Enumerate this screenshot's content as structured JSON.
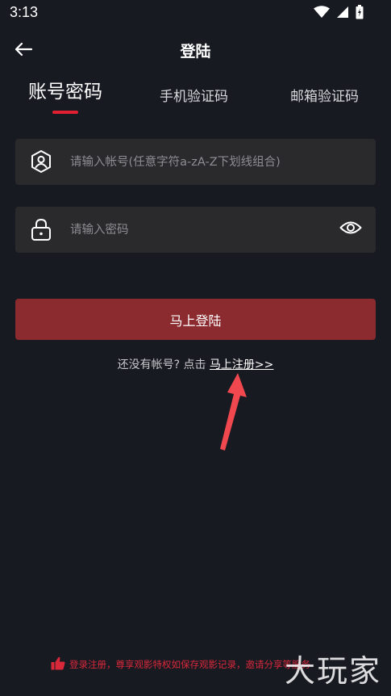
{
  "status_bar": {
    "time": "3:13"
  },
  "header": {
    "title": "登陆"
  },
  "tabs": [
    {
      "label": "账号密码",
      "active": true
    },
    {
      "label": "手机验证码",
      "active": false
    },
    {
      "label": "邮箱验证码",
      "active": false
    }
  ],
  "form": {
    "account": {
      "placeholder": "请输入帐号(任意字符a-zA-Z下划线组合)",
      "value": ""
    },
    "password": {
      "placeholder": "请输入密码",
      "value": ""
    },
    "submit_label": "马上登陆"
  },
  "register": {
    "prompt": "还没有帐号? 点击 ",
    "link_label": "马上注册>>"
  },
  "footer": {
    "tip": "登录注册，尊享观影特权如保存观影记录，邀请分享等服务"
  },
  "watermark": {
    "text": "大玩家"
  },
  "colors": {
    "background": "#181a22",
    "field_bg": "#2a2a2c",
    "accent": "#e02030",
    "button": "#8b2b2f",
    "annotation_arrow": "#f0484e"
  },
  "icons": {
    "back": "arrow-left-icon",
    "account_field": "user-shield-icon",
    "password_field": "lock-icon",
    "password_toggle": "eye-icon",
    "footer_tip": "thumbs-up-icon"
  }
}
